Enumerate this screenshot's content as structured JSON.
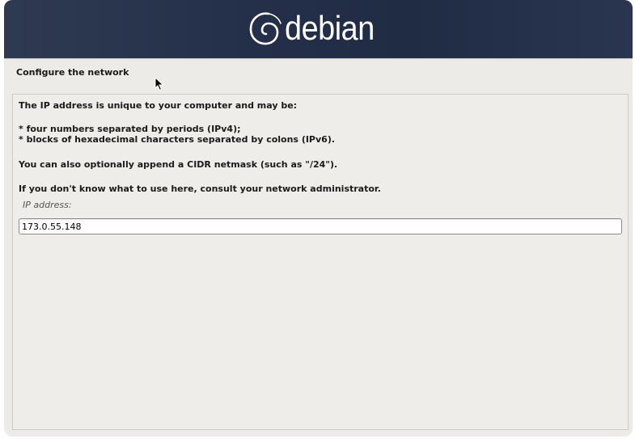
{
  "banner": {
    "logo_text": "debian",
    "logo_icon": "debian-swirl-icon",
    "background_color": "#25304a"
  },
  "step": {
    "title": "Configure the network"
  },
  "content": {
    "intro": "The IP address is unique to your computer and may be:",
    "bullet_1": "* four numbers separated by periods (IPv4);",
    "bullet_2": "* blocks of hexadecimal characters separated by colons (IPv6).",
    "cidr_note": "You can also optionally append a CIDR netmask (such as \"/24\").",
    "consult_note": "If you don't know what to use here, consult your network administrator.",
    "field_label": "IP address:",
    "ip_value": "173.0.55.148"
  },
  "colors": {
    "panel_background": "#edebe7",
    "text": "#1a1a1a"
  }
}
